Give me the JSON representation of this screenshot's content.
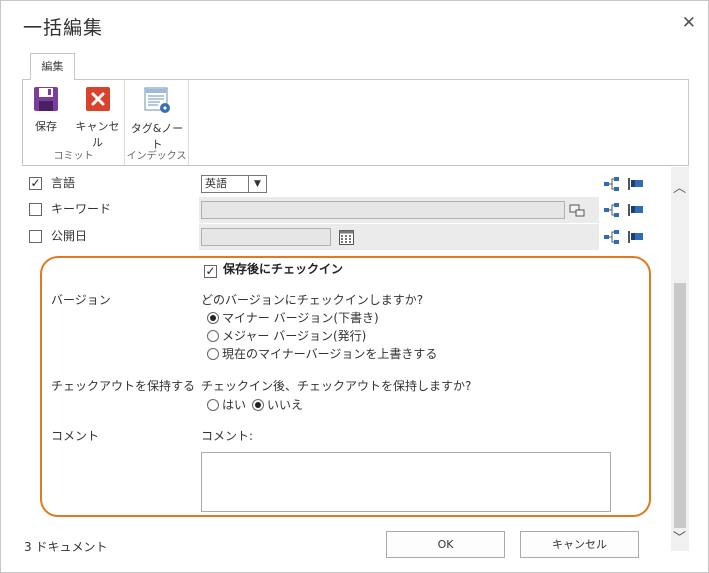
{
  "dialog": {
    "title": "一括編集",
    "close_glyph": "✕"
  },
  "ribbon": {
    "tab_label": "編集",
    "groups": {
      "commit": {
        "label": "コミット",
        "save_label": "保存",
        "cancel_label": "キャンセル"
      },
      "index": {
        "label": "インデックス",
        "tags_label": "タグ&ノート"
      }
    }
  },
  "fields": {
    "language": {
      "label": "言語",
      "checked": true,
      "value": "英語"
    },
    "keywords": {
      "label": "キーワード",
      "checked": false
    },
    "publish_date": {
      "label": "公開日",
      "checked": false
    }
  },
  "checkin": {
    "header": "保存後にチェックイン",
    "checked": true,
    "version": {
      "label": "バージョン",
      "question": "どのバージョンにチェックインしますか?",
      "options": [
        {
          "label": "マイナー バージョン(下書き)",
          "selected": true
        },
        {
          "label": "メジャー バージョン(発行)",
          "selected": false
        },
        {
          "label": "現在のマイナーバージョンを上書きする",
          "selected": false
        }
      ]
    },
    "keep": {
      "label": "チェックアウトを保持する",
      "question": "チェックイン後、チェックアウトを保持しますか?",
      "yes": "はい",
      "no": "いいえ",
      "selected": "no"
    },
    "comment": {
      "label": "コメント",
      "field_label": "コメント:"
    }
  },
  "footer": {
    "count": "3 ドキュメント",
    "ok": "OK",
    "cancel": "キャンセル"
  },
  "colors": {
    "highlight": "#e07a1e",
    "save_icon": "#7b3f9a",
    "cancel_icon": "#d9432b"
  }
}
